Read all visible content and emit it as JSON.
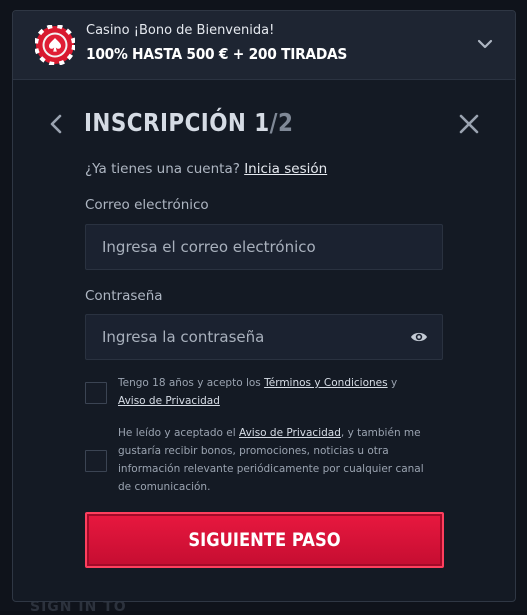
{
  "bonus": {
    "title": "Casino ¡Bono de Bienvenida!",
    "offer": "100% HASTA 500 € + 200 TIRADAS"
  },
  "header": {
    "title": "INSCRIPCIÓN 1",
    "step_separator": "/",
    "step_total": "2"
  },
  "account": {
    "prompt": "¿Ya tienes una cuenta?",
    "login_link": "Inicia sesión"
  },
  "email": {
    "label": "Correo electrónico",
    "placeholder": "Ingresa el correo electrónico",
    "value": ""
  },
  "password": {
    "label": "Contraseña",
    "placeholder": "Ingresa la contraseña",
    "value": ""
  },
  "terms": {
    "text_before": "Tengo 18 años y acepto los ",
    "terms_link": "Términos y Condiciones",
    "text_middle": " y ",
    "privacy_link": "Aviso de Privacidad",
    "checked": false
  },
  "marketing": {
    "text_before": "He leído y aceptado el ",
    "privacy_link": "Aviso de Privacidad",
    "text_after": ", y también me gustaría recibir bonos, promociones, noticias u otra información relevante periódicamente por cualquier canal de comunicación.",
    "checked": false
  },
  "submit": {
    "label": "SIGUIENTE PASO"
  },
  "backdrop": {
    "text": "SIGN IN TO"
  },
  "colors": {
    "accent": "#e8183f",
    "modal_bg": "#141a24",
    "banner_bg": "#1e2532",
    "field_bg": "#1b2230"
  },
  "icons": [
    "poker-chip-icon",
    "chevron-down-icon",
    "chevron-left-icon",
    "close-icon",
    "eye-icon"
  ]
}
